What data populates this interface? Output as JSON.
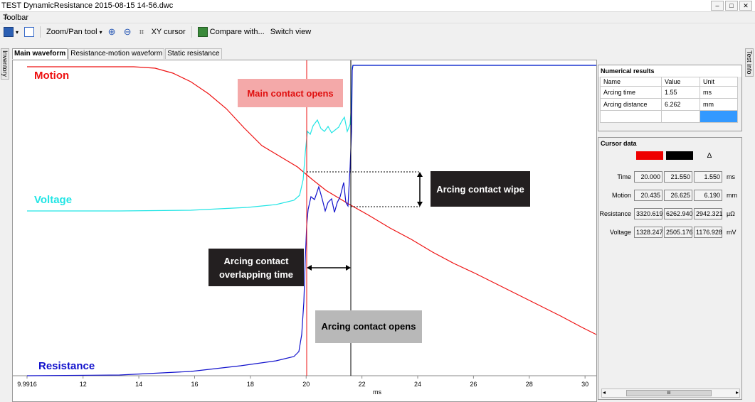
{
  "window": {
    "title": "TEST DynamicResistance 2015-08-15 14-56.dwc"
  },
  "toolbar": {
    "label": "Toolbar",
    "zoom_pan": "Zoom/Pan tool",
    "xy_cursor": "XY cursor",
    "compare": "Compare with...",
    "switch_view": "Switch view"
  },
  "side_tabs": {
    "left": "Inventory",
    "right": "Test info"
  },
  "tabs": [
    {
      "label": "Main waveform",
      "active": true
    },
    {
      "label": "Resistance-motion waveform",
      "active": false
    },
    {
      "label": "Static resistance",
      "active": false
    }
  ],
  "chart_data": {
    "type": "line",
    "xlabel": "ms",
    "x_ticks": [
      "9.9916",
      "12",
      "14",
      "16",
      "18",
      "20",
      "22",
      "24",
      "26",
      "28",
      "30"
    ],
    "xlim": [
      9.9916,
      30.2
    ],
    "series": [
      {
        "name": "Motion",
        "color": "#ee1111"
      },
      {
        "name": "Voltage",
        "color": "#22e5e5"
      },
      {
        "name": "Resistance",
        "color": "#1111cc"
      }
    ],
    "cursors": [
      {
        "x": 20.0,
        "color": "#ee1111"
      },
      {
        "x": 21.55,
        "color": "#000000"
      }
    ],
    "annotations": [
      "Main contact opens",
      "Arcing contact wipe",
      "Arcing contact overlapping time",
      "Arcing contact opens"
    ]
  },
  "numerical_results": {
    "title": "Numerical results",
    "headers": [
      "Name",
      "Value",
      "Unit"
    ],
    "rows": [
      [
        "Arcing time",
        "1.55",
        "ms"
      ],
      [
        "Arcing distance",
        "6.262",
        "mm"
      ]
    ]
  },
  "cursor_data": {
    "title": "Cursor data",
    "delta_symbol": "Δ",
    "colors": {
      "first": "#ee0000",
      "second": "#000000"
    },
    "rows": [
      {
        "label": "Time",
        "values": [
          "20.000",
          "21.550",
          "1.550"
        ],
        "unit": "ms"
      },
      {
        "label": "Motion",
        "values": [
          "20.435",
          "26.625",
          "6.190"
        ],
        "unit": "mm"
      },
      {
        "label": "Resistance",
        "values": [
          "3320.619",
          "6262.940",
          "2942.321"
        ],
        "unit": "µΩ"
      },
      {
        "label": "Voltage",
        "values": [
          "1328.247",
          "2505.176",
          "1176.928"
        ],
        "unit": "mV"
      }
    ],
    "scroll_label": "III"
  }
}
